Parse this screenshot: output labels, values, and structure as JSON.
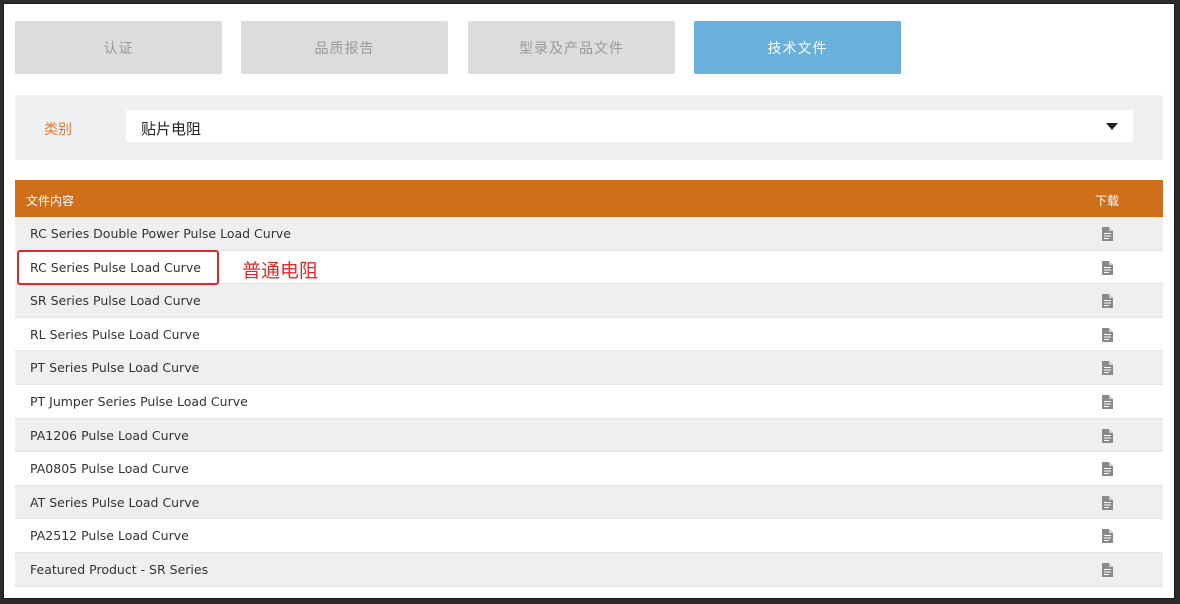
{
  "tabs": [
    {
      "label": "认证",
      "active": false
    },
    {
      "label": "品质报告",
      "active": false
    },
    {
      "label": "型录及产品文件",
      "active": false
    },
    {
      "label": "技术文件",
      "active": true
    }
  ],
  "filter": {
    "label": "类别",
    "selected": "贴片电阻"
  },
  "table": {
    "headers": {
      "content": "文件内容",
      "download": "下载"
    },
    "rows": [
      "RC Series Double Power Pulse Load Curve",
      "RC Series Pulse Load Curve",
      "SR Series Pulse Load Curve",
      "RL Series Pulse Load Curve",
      "PT Series Pulse Load Curve",
      "PT Jumper Series Pulse Load Curve",
      "PA1206 Pulse Load Curve",
      "PA0805 Pulse Load Curve",
      "AT Series Pulse Load Curve",
      "PA2512 Pulse Load Curve",
      "Featured Product - SR Series"
    ],
    "row_icon": "document-icon"
  },
  "annotation": {
    "text": "普通电阻",
    "color": "#e02a2a"
  },
  "colors": {
    "accent_header": "#d06f19",
    "active_tab": "#6ab0dc",
    "filter_label": "#e07b2e"
  }
}
